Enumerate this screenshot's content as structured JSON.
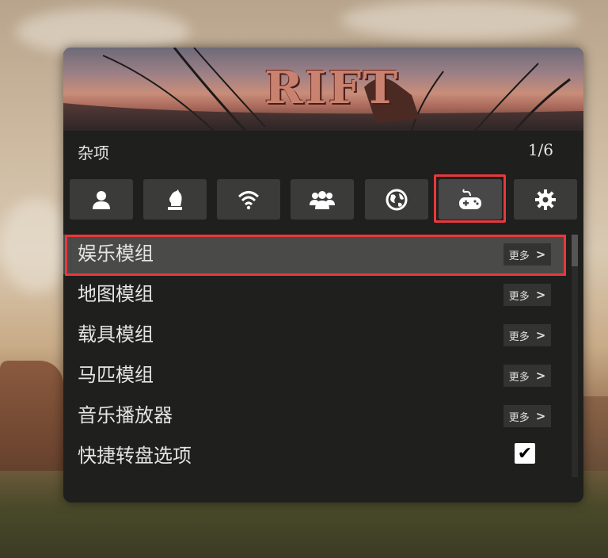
{
  "banner": {
    "logo_text": "RIFT"
  },
  "header": {
    "title": "杂项",
    "page": "1/6"
  },
  "tabs": [
    {
      "icon": "user-icon"
    },
    {
      "icon": "chess-knight-icon"
    },
    {
      "icon": "wifi-icon"
    },
    {
      "icon": "users-icon"
    },
    {
      "icon": "globe-icon"
    },
    {
      "icon": "gamepad-icon",
      "active": true
    },
    {
      "icon": "gear-icon"
    }
  ],
  "menu": {
    "items": [
      {
        "label": "娱乐模组",
        "more": "更多",
        "selected": true
      },
      {
        "label": "地图模组",
        "more": "更多"
      },
      {
        "label": "载具模组",
        "more": "更多"
      },
      {
        "label": "马匹模组",
        "more": "更多"
      },
      {
        "label": "音乐播放器",
        "more": "更多"
      },
      {
        "label": "快捷转盘选项",
        "checked": true
      }
    ],
    "more_chevron": ">"
  },
  "colors": {
    "highlight": "#e8383d",
    "panel": "#1f1f1d",
    "tab": "#3b3b3a"
  }
}
